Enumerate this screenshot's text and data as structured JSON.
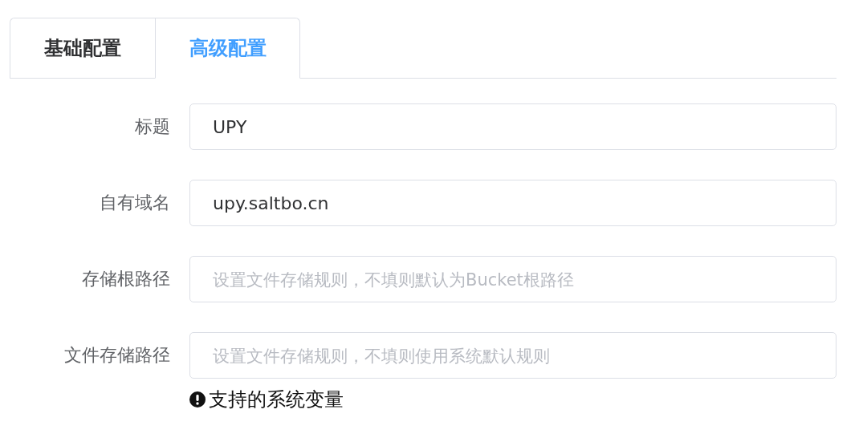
{
  "tabs": [
    {
      "label": "基础配置",
      "selected": false
    },
    {
      "label": "高级配置",
      "selected": true
    }
  ],
  "fields": [
    {
      "label": "标题",
      "value": "UPY"
    },
    {
      "label": "自有域名",
      "value": "upy.saltbo.cn"
    },
    {
      "label": "存储根路径",
      "placeholder": "设置文件存储规则，不填则默认为Bucket根路径"
    },
    {
      "label": "文件存储路径",
      "placeholder": "设置文件存储规则，不填则使用系统默认规则"
    }
  ],
  "hint": "支持的系统变量"
}
